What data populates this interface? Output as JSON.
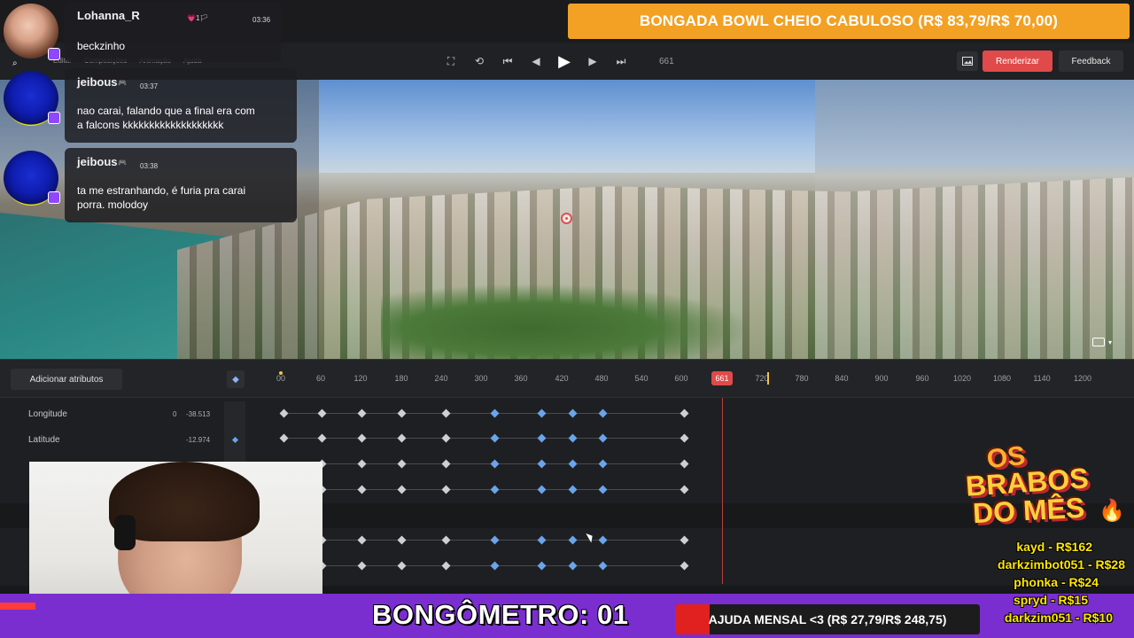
{
  "app": {
    "menu": [
      "Editar",
      "Composições",
      "Animação",
      "Ajuda"
    ],
    "frame_counter": "661",
    "render_label": "Renderizar",
    "feedback_label": "Feedback",
    "colors": {
      "accent": "#e04a4a",
      "keyframe_blue": "#6aa4ea",
      "bg": "#1e1f22"
    }
  },
  "banner": {
    "text": "BONGADA BOWL CHEIO CABULOSO (R$ 83,79/R$ 70,00)",
    "color": "#f2a124"
  },
  "timeline": {
    "add_attributes_label": "Adicionar atributos",
    "ticks": [
      "00",
      "60",
      "120",
      "180",
      "240",
      "300",
      "360",
      "420",
      "480",
      "540",
      "600",
      "720",
      "780",
      "840",
      "900",
      "960",
      "1020",
      "1080",
      "1140",
      "1200"
    ],
    "playhead_frame": "661",
    "tracks": [
      {
        "label": "Longitude",
        "val_a": "0",
        "val_b": "-38.513"
      },
      {
        "label": "Latitude",
        "val_a": "",
        "val_b": "-12.974"
      }
    ]
  },
  "chat": [
    {
      "user": "Lohanna_R",
      "badges": "💗1🏳",
      "time": "03:36",
      "message": "beckzinho"
    },
    {
      "user": "jeibous",
      "badges": "🎮",
      "time": "03:37",
      "message_l1": "nao carai, falando que a final era com",
      "message_l2": "a falcons kkkkkkkkkkkkkkkkkkk"
    },
    {
      "user": "jeibous",
      "badges": "🎮",
      "time": "03:38",
      "message_l1": "ta me estranhando, é furia pra carai",
      "message_l2": "porra. molodoy"
    }
  ],
  "overlay": {
    "bongometro": "BONGÔMETRO: 01",
    "ajuda": {
      "text": "AJUDA MENSAL <3 (R$ 27,79/R$ 248,75)",
      "progress": 0.112
    },
    "brabos_title": [
      "OS",
      "BRABOS",
      "DO MÊS"
    ],
    "donors": [
      "kayd - R$162",
      "darkzimbot051 - R$28",
      "phonka - R$24",
      "spryd - R$15",
      "darkzim051 - R$10"
    ]
  }
}
